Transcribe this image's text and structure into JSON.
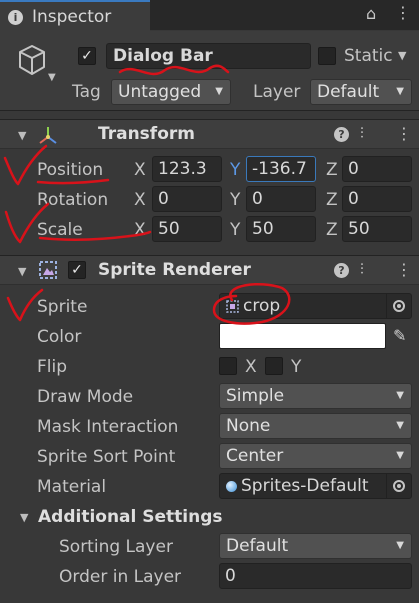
{
  "tab": {
    "label": "Inspector",
    "icon": "info-icon"
  },
  "object": {
    "active": true,
    "name": "Dialog Bar",
    "static_label": "Static",
    "static_checked": false,
    "tag_label": "Tag",
    "tag_value": "Untagged",
    "layer_label": "Layer",
    "layer_value": "Default"
  },
  "transform": {
    "title": "Transform",
    "rows": [
      {
        "label": "Position",
        "x": "123.3",
        "y": "-136.7",
        "z": "0"
      },
      {
        "label": "Rotation",
        "x": "0",
        "y": "0",
        "z": "0"
      },
      {
        "label": "Scale",
        "x": "50",
        "y": "50",
        "z": "50"
      }
    ],
    "axis": {
      "x": "X",
      "y": "Y",
      "z": "Z"
    }
  },
  "sprite_renderer": {
    "title": "Sprite Renderer",
    "enabled": true,
    "sprite_label": "Sprite",
    "sprite_value": "crop",
    "color_label": "Color",
    "color_value": "#ffffff",
    "flip_label": "Flip",
    "flip_x": "X",
    "flip_y": "Y",
    "draw_mode_label": "Draw Mode",
    "draw_mode_value": "Simple",
    "mask_label": "Mask Interaction",
    "mask_value": "None",
    "sort_point_label": "Sprite Sort Point",
    "sort_point_value": "Center",
    "material_label": "Material",
    "material_value": "Sprites-Default",
    "additional_title": "Additional Settings",
    "sorting_layer_label": "Sorting Layer",
    "sorting_layer_value": "Default",
    "order_label": "Order in Layer",
    "order_value": "0"
  },
  "colors": {
    "panel": "#383838",
    "field": "#2a2a2a",
    "focus": "#3a79bb",
    "annotation": "#d8121a"
  }
}
